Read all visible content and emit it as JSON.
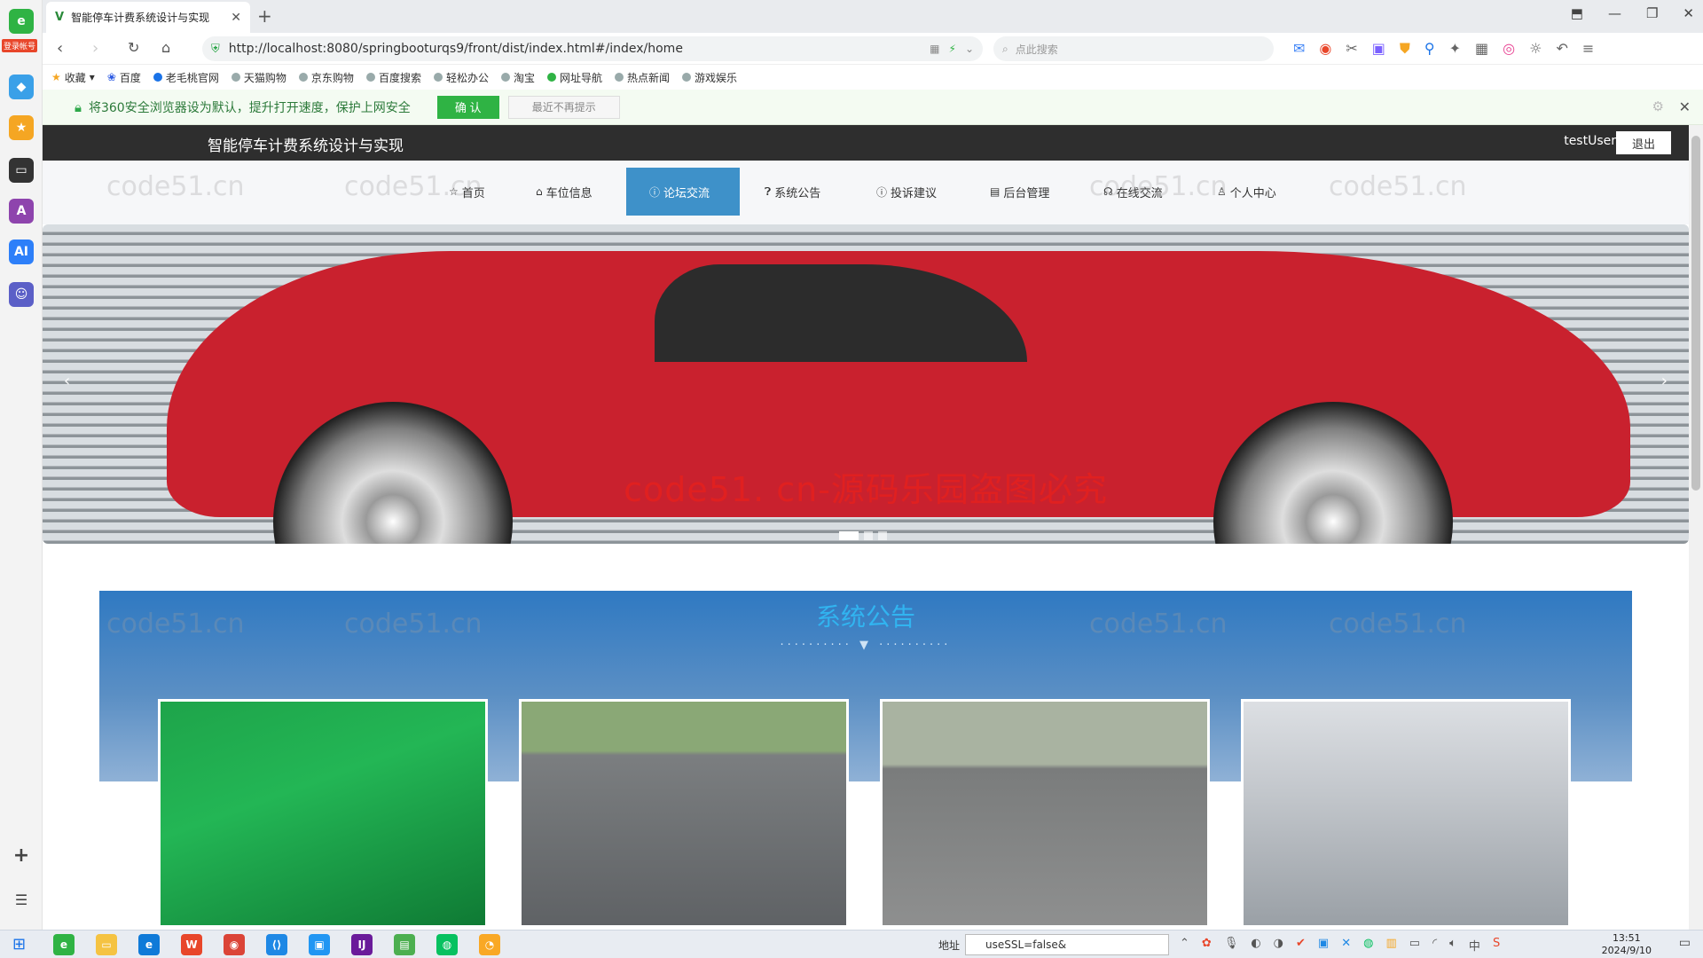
{
  "browser": {
    "tab_title": "智能停车计费系统设计与实现",
    "tab_favicon": "V",
    "new_tab": "+",
    "left_badge": "登录帐号",
    "url": "http://localhost:8080/springbooturqs9/front/dist/index.html#/index/home",
    "search_placeholder": "点此搜索",
    "bookmarks": [
      "收藏",
      "百度",
      "老毛桃官网",
      "天猫购物",
      "京东购物",
      "百度搜索",
      "轻松办公",
      "淘宝",
      "网址导航",
      "热点新闻",
      "游戏娱乐"
    ],
    "security_bar": {
      "text": "将360安全浏览器设为默认，提升打开速度，保护上网安全",
      "confirm": "确 认",
      "dismiss": "最近不再提示"
    }
  },
  "site": {
    "title": "智能停车计费系统设计与实现",
    "user": "testUser",
    "logout": "退出",
    "menu": [
      {
        "label": "首页",
        "icon": "star-icon"
      },
      {
        "label": "车位信息",
        "icon": "home-icon"
      },
      {
        "label": "论坛交流",
        "icon": "info-icon",
        "active": true
      },
      {
        "label": "系统公告",
        "icon": "question-icon"
      },
      {
        "label": "投诉建议",
        "icon": "info-icon"
      },
      {
        "label": "后台管理",
        "icon": "calendar-icon"
      },
      {
        "label": "在线交流",
        "icon": "headset-icon"
      },
      {
        "label": "个人中心",
        "icon": "user-icon"
      }
    ],
    "banner": {
      "caption": "code51. cn-源码乐园盗图必究",
      "slide_count": 3,
      "active_slide": 1
    },
    "notice": {
      "title": "系统公告",
      "divider": "·········· ▼ ··········",
      "cards": [
        "parking-garage-green",
        "roadside-parking",
        "parking-lot",
        "underground-garage-b"
      ]
    },
    "watermark": "code51.cn"
  },
  "taskbar": {
    "address_label": "地址",
    "address_value": "useSSL=false&",
    "time": "13:51",
    "date": "2024/9/10",
    "ime": "中"
  },
  "colors": {
    "header_bg": "#2e2e2e",
    "menu_active": "#3e91c9",
    "notice_title": "#31b4f0",
    "caption": "#e02020",
    "secure_ok": "#2fb344"
  }
}
